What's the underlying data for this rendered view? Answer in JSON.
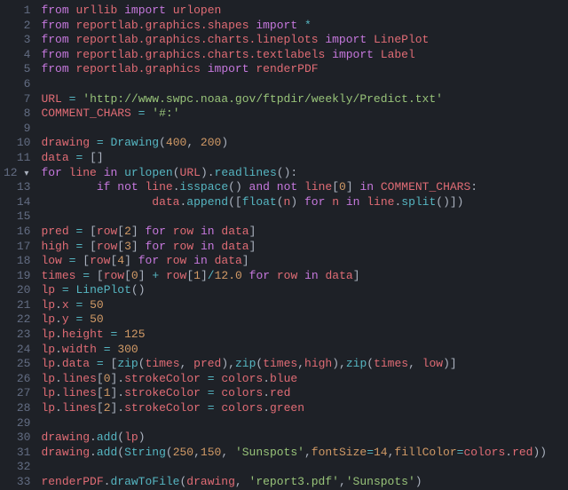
{
  "lines": [
    {
      "n": "1",
      "fold": "",
      "tokens": [
        [
          "kw",
          "from"
        ],
        [
          "pn",
          " "
        ],
        [
          "id",
          "urllib"
        ],
        [
          "pn",
          " "
        ],
        [
          "kw",
          "import"
        ],
        [
          "pn",
          " "
        ],
        [
          "id",
          "urlopen"
        ]
      ]
    },
    {
      "n": "2",
      "fold": "",
      "tokens": [
        [
          "kw",
          "from"
        ],
        [
          "pn",
          " "
        ],
        [
          "id",
          "reportlab.graphics.shapes"
        ],
        [
          "pn",
          " "
        ],
        [
          "kw",
          "import"
        ],
        [
          "pn",
          " "
        ],
        [
          "op",
          "*"
        ]
      ]
    },
    {
      "n": "3",
      "fold": "",
      "tokens": [
        [
          "kw",
          "from"
        ],
        [
          "pn",
          " "
        ],
        [
          "id",
          "reportlab.graphics.charts.lineplots"
        ],
        [
          "pn",
          " "
        ],
        [
          "kw",
          "import"
        ],
        [
          "pn",
          " "
        ],
        [
          "id",
          "LinePlot"
        ]
      ]
    },
    {
      "n": "4",
      "fold": "",
      "tokens": [
        [
          "kw",
          "from"
        ],
        [
          "pn",
          " "
        ],
        [
          "id",
          "reportlab.graphics.charts.textlabels"
        ],
        [
          "pn",
          " "
        ],
        [
          "kw",
          "import"
        ],
        [
          "pn",
          " "
        ],
        [
          "id",
          "Label"
        ]
      ]
    },
    {
      "n": "5",
      "fold": "",
      "tokens": [
        [
          "kw",
          "from"
        ],
        [
          "pn",
          " "
        ],
        [
          "id",
          "reportlab.graphics"
        ],
        [
          "pn",
          " "
        ],
        [
          "kw",
          "import"
        ],
        [
          "pn",
          " "
        ],
        [
          "id",
          "renderPDF"
        ]
      ]
    },
    {
      "n": "6",
      "fold": "",
      "tokens": []
    },
    {
      "n": "7",
      "fold": "",
      "tokens": [
        [
          "id",
          "URL"
        ],
        [
          "pn",
          " "
        ],
        [
          "op",
          "="
        ],
        [
          "pn",
          " "
        ],
        [
          "st",
          "'http://www.swpc.noaa.gov/ftpdir/weekly/Predict.txt'"
        ]
      ]
    },
    {
      "n": "8",
      "fold": "",
      "tokens": [
        [
          "id",
          "COMMENT_CHARS"
        ],
        [
          "pn",
          " "
        ],
        [
          "op",
          "="
        ],
        [
          "pn",
          " "
        ],
        [
          "st",
          "'#:'"
        ]
      ]
    },
    {
      "n": "9",
      "fold": "",
      "tokens": []
    },
    {
      "n": "10",
      "fold": "",
      "tokens": [
        [
          "id",
          "drawing"
        ],
        [
          "pn",
          " "
        ],
        [
          "op",
          "="
        ],
        [
          "pn",
          " "
        ],
        [
          "fn",
          "Drawing"
        ],
        [
          "pn",
          "("
        ],
        [
          "nu",
          "400"
        ],
        [
          "pn",
          ", "
        ],
        [
          "nu",
          "200"
        ],
        [
          "pn",
          ")"
        ]
      ]
    },
    {
      "n": "11",
      "fold": "",
      "tokens": [
        [
          "id",
          "data"
        ],
        [
          "pn",
          " "
        ],
        [
          "op",
          "="
        ],
        [
          "pn",
          " []"
        ]
      ]
    },
    {
      "n": "12",
      "fold": "▾",
      "tokens": [
        [
          "kw",
          "for"
        ],
        [
          "pn",
          " "
        ],
        [
          "id",
          "line"
        ],
        [
          "pn",
          " "
        ],
        [
          "kw",
          "in"
        ],
        [
          "pn",
          " "
        ],
        [
          "fn",
          "urlopen"
        ],
        [
          "pn",
          "("
        ],
        [
          "id",
          "URL"
        ],
        [
          "pn",
          ")."
        ],
        [
          "fn",
          "readlines"
        ],
        [
          "pn",
          "():"
        ]
      ]
    },
    {
      "n": "13",
      "fold": "",
      "tokens": [
        [
          "pn",
          "        "
        ],
        [
          "kw",
          "if"
        ],
        [
          "pn",
          " "
        ],
        [
          "kw",
          "not"
        ],
        [
          "pn",
          " "
        ],
        [
          "id",
          "line"
        ],
        [
          "pn",
          "."
        ],
        [
          "fn",
          "isspace"
        ],
        [
          "pn",
          "() "
        ],
        [
          "kw",
          "and"
        ],
        [
          "pn",
          " "
        ],
        [
          "kw",
          "not"
        ],
        [
          "pn",
          " "
        ],
        [
          "id",
          "line"
        ],
        [
          "pn",
          "["
        ],
        [
          "nu",
          "0"
        ],
        [
          "pn",
          "] "
        ],
        [
          "kw",
          "in"
        ],
        [
          "pn",
          " "
        ],
        [
          "id",
          "COMMENT_CHARS"
        ],
        [
          "pn",
          ":"
        ]
      ]
    },
    {
      "n": "14",
      "fold": "",
      "tokens": [
        [
          "pn",
          "                "
        ],
        [
          "id",
          "data"
        ],
        [
          "pn",
          "."
        ],
        [
          "fn",
          "append"
        ],
        [
          "pn",
          "(["
        ],
        [
          "fn",
          "float"
        ],
        [
          "pn",
          "("
        ],
        [
          "id",
          "n"
        ],
        [
          "pn",
          ") "
        ],
        [
          "kw",
          "for"
        ],
        [
          "pn",
          " "
        ],
        [
          "id",
          "n"
        ],
        [
          "pn",
          " "
        ],
        [
          "kw",
          "in"
        ],
        [
          "pn",
          " "
        ],
        [
          "id",
          "line"
        ],
        [
          "pn",
          "."
        ],
        [
          "fn",
          "split"
        ],
        [
          "pn",
          "()])"
        ]
      ]
    },
    {
      "n": "15",
      "fold": "",
      "tokens": []
    },
    {
      "n": "16",
      "fold": "",
      "tokens": [
        [
          "id",
          "pred"
        ],
        [
          "pn",
          " "
        ],
        [
          "op",
          "="
        ],
        [
          "pn",
          " ["
        ],
        [
          "id",
          "row"
        ],
        [
          "pn",
          "["
        ],
        [
          "nu",
          "2"
        ],
        [
          "pn",
          "] "
        ],
        [
          "kw",
          "for"
        ],
        [
          "pn",
          " "
        ],
        [
          "id",
          "row"
        ],
        [
          "pn",
          " "
        ],
        [
          "kw",
          "in"
        ],
        [
          "pn",
          " "
        ],
        [
          "id",
          "data"
        ],
        [
          "pn",
          "]"
        ]
      ]
    },
    {
      "n": "17",
      "fold": "",
      "tokens": [
        [
          "id",
          "high"
        ],
        [
          "pn",
          " "
        ],
        [
          "op",
          "="
        ],
        [
          "pn",
          " ["
        ],
        [
          "id",
          "row"
        ],
        [
          "pn",
          "["
        ],
        [
          "nu",
          "3"
        ],
        [
          "pn",
          "] "
        ],
        [
          "kw",
          "for"
        ],
        [
          "pn",
          " "
        ],
        [
          "id",
          "row"
        ],
        [
          "pn",
          " "
        ],
        [
          "kw",
          "in"
        ],
        [
          "pn",
          " "
        ],
        [
          "id",
          "data"
        ],
        [
          "pn",
          "]"
        ]
      ]
    },
    {
      "n": "18",
      "fold": "",
      "tokens": [
        [
          "id",
          "low"
        ],
        [
          "pn",
          " "
        ],
        [
          "op",
          "="
        ],
        [
          "pn",
          " ["
        ],
        [
          "id",
          "row"
        ],
        [
          "pn",
          "["
        ],
        [
          "nu",
          "4"
        ],
        [
          "pn",
          "] "
        ],
        [
          "kw",
          "for"
        ],
        [
          "pn",
          " "
        ],
        [
          "id",
          "row"
        ],
        [
          "pn",
          " "
        ],
        [
          "kw",
          "in"
        ],
        [
          "pn",
          " "
        ],
        [
          "id",
          "data"
        ],
        [
          "pn",
          "]"
        ]
      ]
    },
    {
      "n": "19",
      "fold": "",
      "tokens": [
        [
          "id",
          "times"
        ],
        [
          "pn",
          " "
        ],
        [
          "op",
          "="
        ],
        [
          "pn",
          " ["
        ],
        [
          "id",
          "row"
        ],
        [
          "pn",
          "["
        ],
        [
          "nu",
          "0"
        ],
        [
          "pn",
          "] "
        ],
        [
          "op",
          "+"
        ],
        [
          "pn",
          " "
        ],
        [
          "id",
          "row"
        ],
        [
          "pn",
          "["
        ],
        [
          "nu",
          "1"
        ],
        [
          "pn",
          "]"
        ],
        [
          "op",
          "/"
        ],
        [
          "nu",
          "12.0"
        ],
        [
          "pn",
          " "
        ],
        [
          "kw",
          "for"
        ],
        [
          "pn",
          " "
        ],
        [
          "id",
          "row"
        ],
        [
          "pn",
          " "
        ],
        [
          "kw",
          "in"
        ],
        [
          "pn",
          " "
        ],
        [
          "id",
          "data"
        ],
        [
          "pn",
          "]"
        ]
      ]
    },
    {
      "n": "20",
      "fold": "",
      "tokens": [
        [
          "id",
          "lp"
        ],
        [
          "pn",
          " "
        ],
        [
          "op",
          "="
        ],
        [
          "pn",
          " "
        ],
        [
          "fn",
          "LinePlot"
        ],
        [
          "pn",
          "()"
        ]
      ]
    },
    {
      "n": "21",
      "fold": "",
      "tokens": [
        [
          "id",
          "lp"
        ],
        [
          "pn",
          "."
        ],
        [
          "id",
          "x"
        ],
        [
          "pn",
          " "
        ],
        [
          "op",
          "="
        ],
        [
          "pn",
          " "
        ],
        [
          "nu",
          "50"
        ]
      ]
    },
    {
      "n": "22",
      "fold": "",
      "tokens": [
        [
          "id",
          "lp"
        ],
        [
          "pn",
          "."
        ],
        [
          "id",
          "y"
        ],
        [
          "pn",
          " "
        ],
        [
          "op",
          "="
        ],
        [
          "pn",
          " "
        ],
        [
          "nu",
          "50"
        ]
      ]
    },
    {
      "n": "23",
      "fold": "",
      "tokens": [
        [
          "id",
          "lp"
        ],
        [
          "pn",
          "."
        ],
        [
          "id",
          "height"
        ],
        [
          "pn",
          " "
        ],
        [
          "op",
          "="
        ],
        [
          "pn",
          " "
        ],
        [
          "nu",
          "125"
        ]
      ]
    },
    {
      "n": "24",
      "fold": "",
      "tokens": [
        [
          "id",
          "lp"
        ],
        [
          "pn",
          "."
        ],
        [
          "id",
          "width"
        ],
        [
          "pn",
          " "
        ],
        [
          "op",
          "="
        ],
        [
          "pn",
          " "
        ],
        [
          "nu",
          "300"
        ]
      ]
    },
    {
      "n": "25",
      "fold": "",
      "tokens": [
        [
          "id",
          "lp"
        ],
        [
          "pn",
          "."
        ],
        [
          "id",
          "data"
        ],
        [
          "pn",
          " "
        ],
        [
          "op",
          "="
        ],
        [
          "pn",
          " ["
        ],
        [
          "fn",
          "zip"
        ],
        [
          "pn",
          "("
        ],
        [
          "id",
          "times"
        ],
        [
          "pn",
          ", "
        ],
        [
          "id",
          "pred"
        ],
        [
          "pn",
          "),"
        ],
        [
          "fn",
          "zip"
        ],
        [
          "pn",
          "("
        ],
        [
          "id",
          "times"
        ],
        [
          "pn",
          ","
        ],
        [
          "id",
          "high"
        ],
        [
          "pn",
          "),"
        ],
        [
          "fn",
          "zip"
        ],
        [
          "pn",
          "("
        ],
        [
          "id",
          "times"
        ],
        [
          "pn",
          ", "
        ],
        [
          "id",
          "low"
        ],
        [
          "pn",
          ")]"
        ]
      ]
    },
    {
      "n": "26",
      "fold": "",
      "tokens": [
        [
          "id",
          "lp"
        ],
        [
          "pn",
          "."
        ],
        [
          "id",
          "lines"
        ],
        [
          "pn",
          "["
        ],
        [
          "nu",
          "0"
        ],
        [
          "pn",
          "]."
        ],
        [
          "id",
          "strokeColor"
        ],
        [
          "pn",
          " "
        ],
        [
          "op",
          "="
        ],
        [
          "pn",
          " "
        ],
        [
          "id",
          "colors"
        ],
        [
          "pn",
          "."
        ],
        [
          "id",
          "blue"
        ]
      ]
    },
    {
      "n": "27",
      "fold": "",
      "tokens": [
        [
          "id",
          "lp"
        ],
        [
          "pn",
          "."
        ],
        [
          "id",
          "lines"
        ],
        [
          "pn",
          "["
        ],
        [
          "nu",
          "1"
        ],
        [
          "pn",
          "]."
        ],
        [
          "id",
          "strokeColor"
        ],
        [
          "pn",
          " "
        ],
        [
          "op",
          "="
        ],
        [
          "pn",
          " "
        ],
        [
          "id",
          "colors"
        ],
        [
          "pn",
          "."
        ],
        [
          "id",
          "red"
        ]
      ]
    },
    {
      "n": "28",
      "fold": "",
      "tokens": [
        [
          "id",
          "lp"
        ],
        [
          "pn",
          "."
        ],
        [
          "id",
          "lines"
        ],
        [
          "pn",
          "["
        ],
        [
          "nu",
          "2"
        ],
        [
          "pn",
          "]."
        ],
        [
          "id",
          "strokeColor"
        ],
        [
          "pn",
          " "
        ],
        [
          "op",
          "="
        ],
        [
          "pn",
          " "
        ],
        [
          "id",
          "colors"
        ],
        [
          "pn",
          "."
        ],
        [
          "id",
          "green"
        ]
      ]
    },
    {
      "n": "29",
      "fold": "",
      "tokens": []
    },
    {
      "n": "30",
      "fold": "",
      "tokens": [
        [
          "id",
          "drawing"
        ],
        [
          "pn",
          "."
        ],
        [
          "fn",
          "add"
        ],
        [
          "pn",
          "("
        ],
        [
          "id",
          "lp"
        ],
        [
          "pn",
          ")"
        ]
      ]
    },
    {
      "n": "31",
      "fold": "",
      "tokens": [
        [
          "id",
          "drawing"
        ],
        [
          "pn",
          "."
        ],
        [
          "fn",
          "add"
        ],
        [
          "pn",
          "("
        ],
        [
          "fn",
          "String"
        ],
        [
          "pn",
          "("
        ],
        [
          "nu",
          "250"
        ],
        [
          "pn",
          ","
        ],
        [
          "nu",
          "150"
        ],
        [
          "pn",
          ", "
        ],
        [
          "st",
          "'Sunspots'"
        ],
        [
          "pn",
          ","
        ],
        [
          "pr",
          "fontSize"
        ],
        [
          "op",
          "="
        ],
        [
          "nu",
          "14"
        ],
        [
          "pn",
          ","
        ],
        [
          "pr",
          "fillColor"
        ],
        [
          "op",
          "="
        ],
        [
          "id",
          "colors"
        ],
        [
          "pn",
          "."
        ],
        [
          "id",
          "red"
        ],
        [
          "pn",
          "))"
        ]
      ]
    },
    {
      "n": "32",
      "fold": "",
      "tokens": []
    },
    {
      "n": "33",
      "fold": "",
      "tokens": [
        [
          "id",
          "renderPDF"
        ],
        [
          "pn",
          "."
        ],
        [
          "fn",
          "drawToFile"
        ],
        [
          "pn",
          "("
        ],
        [
          "id",
          "drawing"
        ],
        [
          "pn",
          ", "
        ],
        [
          "st",
          "'report3.pdf'"
        ],
        [
          "pn",
          ","
        ],
        [
          "st",
          "'Sunspots'"
        ],
        [
          "pn",
          ")"
        ]
      ]
    }
  ]
}
